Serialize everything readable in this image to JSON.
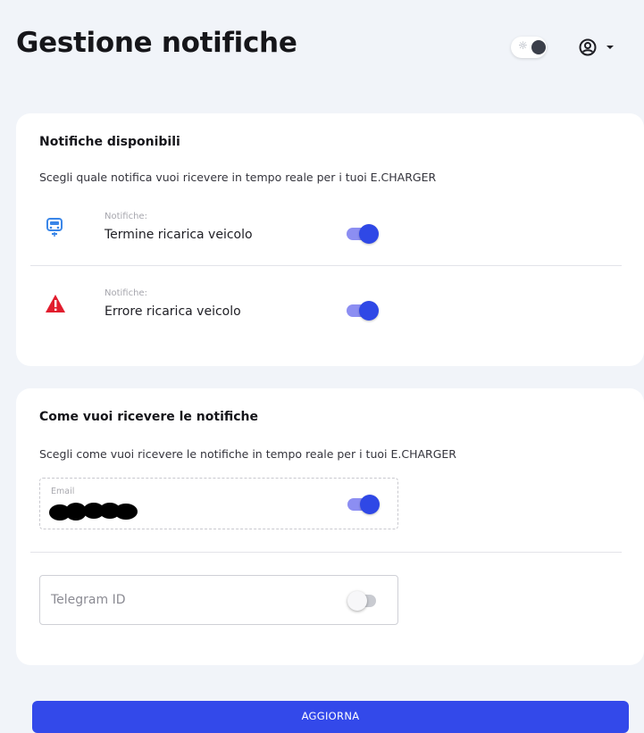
{
  "page": {
    "title": "Gestione notifiche"
  },
  "header": {
    "theme_toggle_icon": "sun-icon",
    "account_icon": "user-circle-icon",
    "dropdown_icon": "caret-down-icon"
  },
  "available_notifications": {
    "title": "Notifiche disponibili",
    "description": "Scegli quale notifica vuoi ricevere in tempo reale per i tuoi E.CHARGER",
    "items": [
      {
        "icon": "charging-station-icon",
        "small_label": "Notifiche:",
        "label": "Termine ricarica veicolo",
        "enabled": true
      },
      {
        "icon": "warning-triangle-icon",
        "small_label": "Notifiche:",
        "label": "Errore ricarica veicolo",
        "enabled": true
      }
    ]
  },
  "delivery": {
    "title": "Come vuoi ricevere le notifiche",
    "description": "Scegli come vuoi ricevere le notifiche in tempo reale per i tuoi E.CHARGER",
    "email": {
      "label": "Email",
      "value_redacted": true,
      "enabled": true
    },
    "telegram": {
      "placeholder": "Telegram ID",
      "enabled": false
    }
  },
  "actions": {
    "submit_label": "AGGIORNA"
  },
  "colors": {
    "accent": "#3349ea",
    "switch_on_track": "#8c8ef2",
    "warning": "#e11d2e",
    "info_icon": "#3a86e8",
    "background": "#f1f4f9"
  }
}
